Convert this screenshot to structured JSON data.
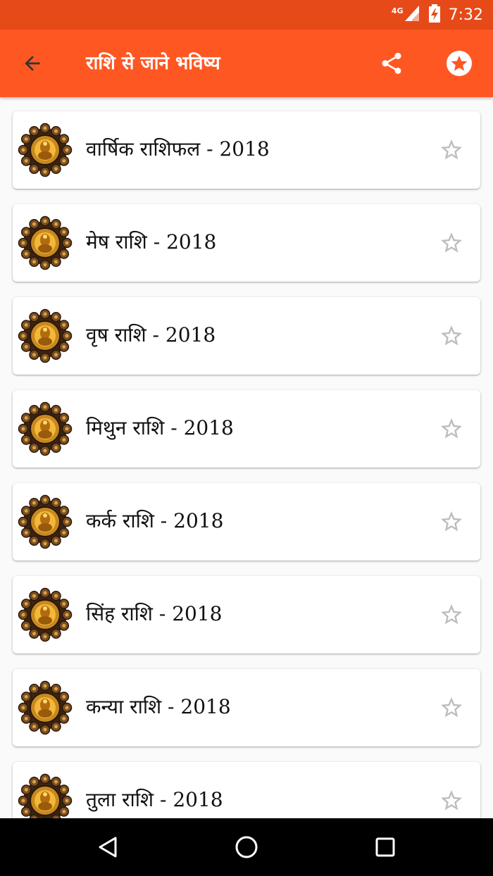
{
  "status_bar": {
    "network": "4G",
    "time": "7:32"
  },
  "app_bar": {
    "title": "राशि से जाने भविष्य",
    "back_icon": "arrow-back-icon",
    "share_icon": "share-icon",
    "favorite_icon": "star-circle-icon"
  },
  "items": [
    {
      "label": "वार्षिक राशिफल - 2018",
      "thumb_icon": "zodiac-wheel-icon",
      "star_icon": "star-outline-icon"
    },
    {
      "label": "मेष राशि - 2018",
      "thumb_icon": "zodiac-wheel-icon",
      "star_icon": "star-outline-icon"
    },
    {
      "label": "वृष राशि - 2018",
      "thumb_icon": "zodiac-wheel-icon",
      "star_icon": "star-outline-icon"
    },
    {
      "label": "मिथुन राशि - 2018",
      "thumb_icon": "zodiac-wheel-icon",
      "star_icon": "star-outline-icon"
    },
    {
      "label": "कर्क राशि - 2018",
      "thumb_icon": "zodiac-wheel-icon",
      "star_icon": "star-outline-icon"
    },
    {
      "label": "सिंह राशि - 2018",
      "thumb_icon": "zodiac-wheel-icon",
      "star_icon": "star-outline-icon"
    },
    {
      "label": "कन्या राशि - 2018",
      "thumb_icon": "zodiac-wheel-icon",
      "star_icon": "star-outline-icon"
    },
    {
      "label": "तुला राशि - 2018",
      "thumb_icon": "zodiac-wheel-icon",
      "star_icon": "star-outline-icon"
    }
  ],
  "nav_bar": {
    "back_icon": "nav-back-triangle-icon",
    "home_icon": "nav-home-circle-icon",
    "recents_icon": "nav-recents-square-icon"
  },
  "colors": {
    "status_bar": "#e64a19",
    "app_bar": "#ff5722",
    "star_outline": "#bdbdbd"
  }
}
